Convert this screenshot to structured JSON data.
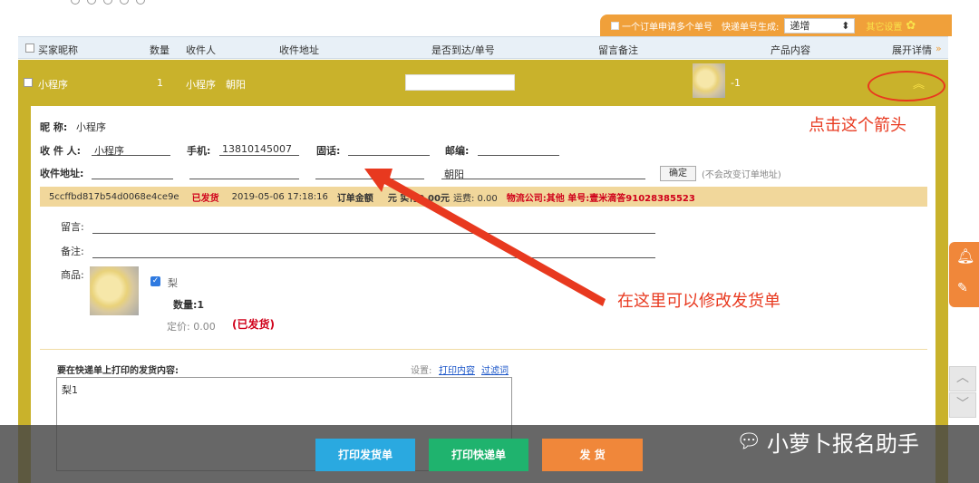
{
  "top_bar": {
    "multi_label": "一个订单申请多个单号",
    "generate_label": "快递单号生成:",
    "select_value": "递增",
    "other_settings": "其它设置"
  },
  "table_header": {
    "nickname": "买家昵称",
    "quantity": "数量",
    "recipient": "收件人",
    "address": "收件地址",
    "arrived": "是否到达/单号",
    "note": "留言备注",
    "product": "产品内容",
    "expand": "展开详情"
  },
  "order_row": {
    "nickname": "小程序",
    "quantity": "1",
    "recipient": "小程序",
    "address": "朝阳",
    "product": "-1"
  },
  "detail": {
    "nickname_label": "昵 称:",
    "nickname_value": "小程序",
    "recipient_label": "收 件 人:",
    "recipient_value": "小程序",
    "mobile_label": "手机:",
    "mobile_value": "13810145007",
    "phone_label": "固话:",
    "zip_label": "邮编:",
    "address_label": "收件地址:",
    "address_district": "朝阳",
    "confirm_button": "确定",
    "confirm_hint": "(不会改变订单地址)"
  },
  "info_bar": {
    "order_id": "5ccffbd817b54d0068e4ce9e",
    "status": "已发货",
    "datetime": "2019-05-06 17:18:16",
    "amount_label": "订单金额",
    "amount_tail": "元 实付0.00元",
    "freight": "运费: 0.00",
    "logistics": "物流公司:其他 单号:壹米滴答91028385523"
  },
  "items": {
    "message_label": "留言:",
    "remark_label": "备注:",
    "product_label": "商品:",
    "product_name": "梨",
    "quantity": "数量:1",
    "price": "定价: 0.00",
    "shipped": "(已发货)"
  },
  "print": {
    "title": "要在快递单上打印的发货内容:",
    "settings_label": "设置:",
    "print_content_link": "打印内容",
    "filter_link": "过滤词",
    "content": "梨1"
  },
  "annotations": {
    "click_arrow": "点击这个箭头",
    "modify_here": "在这里可以修改发货单"
  },
  "bottom": {
    "print_invoice": "打印发货单",
    "print_express": "打印快递单",
    "ship": "发 货",
    "watermark": "小萝卜报名助手"
  },
  "colors": {
    "olive": "#c9b22b",
    "orange": "#f0873a",
    "blue_btn": "#2aa9e0",
    "green_btn": "#1fb36e",
    "annotation_red": "#e8391f"
  }
}
